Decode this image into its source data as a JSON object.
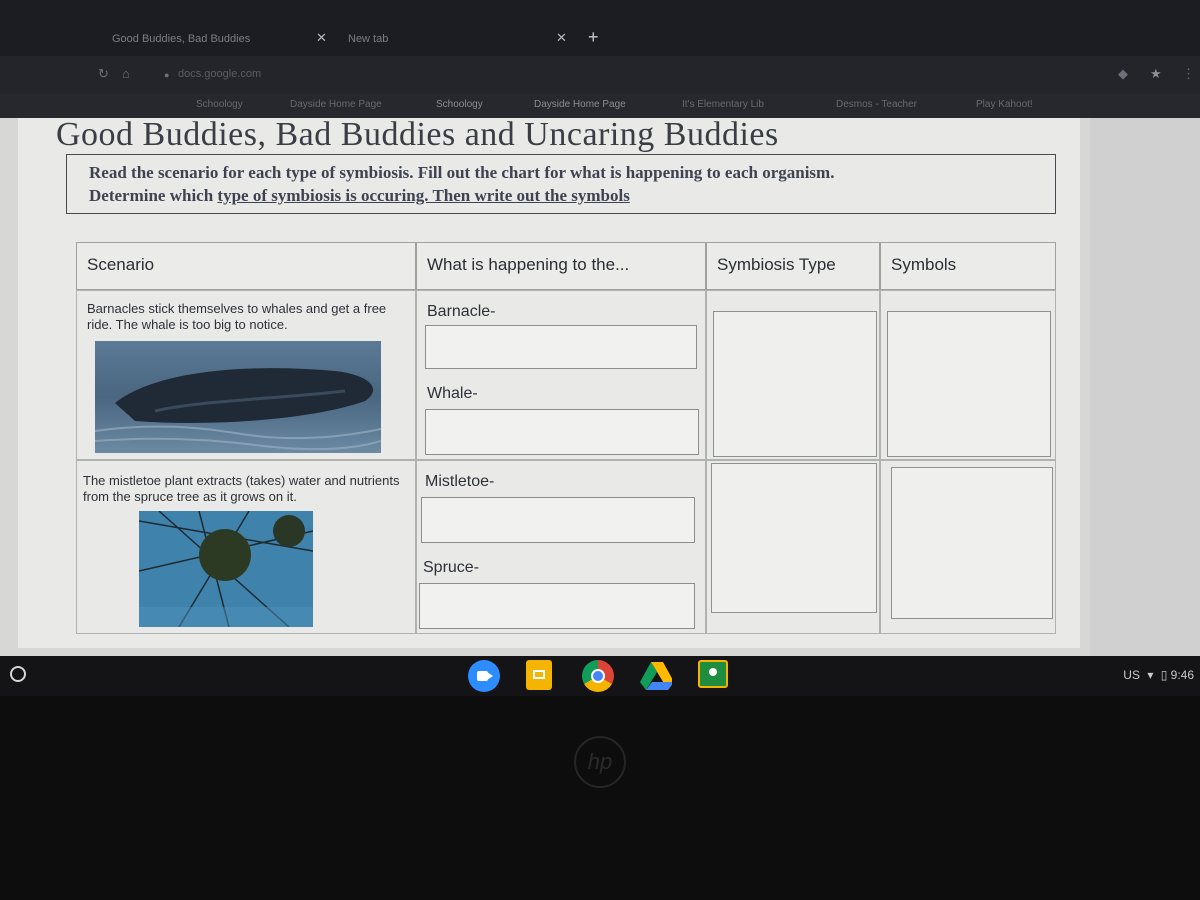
{
  "browser": {
    "tabs": [
      {
        "label": "Good Buddies, Bad Buddies"
      },
      {
        "label": "New tab"
      }
    ],
    "url": "docs.google.com",
    "bookmarks": [
      {
        "label": "Schoology"
      },
      {
        "label": "Dayside Home Page"
      },
      {
        "label": "Schoology"
      },
      {
        "label": "Dayside Home Page"
      },
      {
        "label": "It's Elementary Lib"
      },
      {
        "label": "Desmos - Teacher"
      },
      {
        "label": "Play Kahoot!"
      }
    ]
  },
  "document": {
    "title": "Good Buddies, Bad Buddies and Uncaring Buddies",
    "instructions": {
      "line1": "Read the scenario for each type of symbiosis. Fill out the chart for what is happening to each organism.",
      "line2_prefix": "Determine which ",
      "line2_underlined": "type of symbiosis is occuring. Then write out the symbols"
    },
    "table": {
      "headers": [
        "Scenario",
        "What is happening to the...",
        "Symbiosis Type",
        "Symbols"
      ],
      "rows": [
        {
          "scenario": "Barnacles stick themselves to whales and get a free ride. The whale is too big to notice.",
          "organism1": "Barnacle-",
          "organism2": "Whale-",
          "image": "whale-photo"
        },
        {
          "scenario": "The mistletoe plant extracts (takes) water and nutrients from the spruce tree as it grows on it.",
          "organism1": "Mistletoe-",
          "organism2": "Spruce-",
          "image": "mistletoe-photo"
        }
      ]
    }
  },
  "shelf": {
    "apps": [
      "zoom-icon",
      "slides-icon",
      "chrome-icon",
      "drive-icon",
      "classroom-icon"
    ],
    "locale": "US",
    "time": "9:46"
  }
}
